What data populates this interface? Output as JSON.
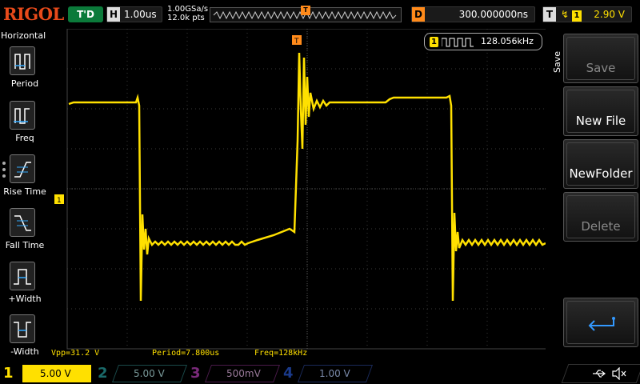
{
  "brand": "RIGOL",
  "top": {
    "run_status": "T'D",
    "horizontal_key": "H",
    "timebase": "1.00us",
    "sample_rate": "1.00GSa/s",
    "mem_depth": "12.0k pts",
    "delay_key": "D",
    "delay": "300.000000ns",
    "trigger_key": "T",
    "trigger_channel": "1",
    "trigger_level": "2.90 V"
  },
  "left_panel": {
    "title": "Horizontal",
    "items": [
      {
        "label": "Period",
        "icon": "period-icon"
      },
      {
        "label": "Freq",
        "icon": "freq-icon"
      },
      {
        "label": "Rise Time",
        "icon": "rise-time-icon"
      },
      {
        "label": "Fall Time",
        "icon": "fall-time-icon"
      },
      {
        "label": "+Width",
        "icon": "pos-width-icon"
      },
      {
        "label": "-Width",
        "icon": "neg-width-icon"
      }
    ]
  },
  "freq_counter": {
    "channel": "1",
    "value": "128.056kHz"
  },
  "markers": {
    "ch1_offset": "1",
    "trigger_pos": "T"
  },
  "right_panel": {
    "menu_title": "Save",
    "softkeys": [
      {
        "label": "Save",
        "disabled": true
      },
      {
        "label": "New File",
        "disabled": false
      },
      {
        "label": "NewFolder",
        "disabled": false
      },
      {
        "label": "Delete",
        "disabled": true
      },
      {
        "label": "",
        "icon": "return-icon"
      }
    ]
  },
  "measurements": {
    "vpp": "Vpp=31.2 V",
    "period": "Period=7.800us",
    "freq": "Freq=128kHz"
  },
  "channels": [
    {
      "num": "1",
      "scale": "5.00 V",
      "active": true,
      "color": "#ffe000"
    },
    {
      "num": "2",
      "scale": "5.00 V",
      "active": false,
      "color": "#1a8a8a"
    },
    {
      "num": "3",
      "scale": "500mV",
      "active": false,
      "color": "#a03aa0"
    },
    {
      "num": "4",
      "scale": "1.00 V",
      "active": false,
      "color": "#2a4aaa"
    }
  ],
  "colors": {
    "trace": "#ffe000",
    "trigger": "#ff8a1a",
    "brand": "#e84a1a",
    "run": "#0b7a3a"
  }
}
